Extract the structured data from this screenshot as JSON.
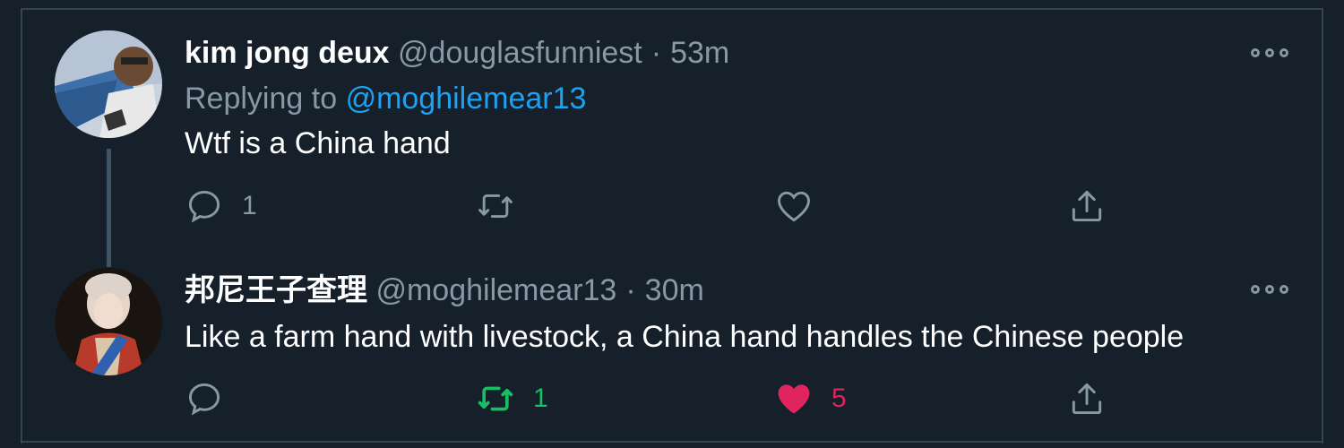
{
  "colors": {
    "background": "#15202b",
    "border": "#38444d",
    "secondary_text": "#8899a6",
    "link": "#1da1f2",
    "retweet_active": "#17bf63",
    "like_active": "#e0245e"
  },
  "tweets": [
    {
      "display_name": "kim jong deux",
      "handle": "@douglasfunniest",
      "separator": "·",
      "time": "53m",
      "replying_prefix": "Replying to",
      "replying_to": "@moghilemear13",
      "text": "Wtf is a China hand",
      "avatar_icon": "avatar-man-photo",
      "actions": {
        "reply_icon": "reply-icon",
        "reply_count": "1",
        "retweet_icon": "retweet-icon",
        "retweet_count": "",
        "like_icon": "heart-outline-icon",
        "like_count": "",
        "share_icon": "share-icon"
      }
    },
    {
      "display_name": "邦尼王子查理",
      "handle": "@moghilemear13",
      "separator": "·",
      "time": "30m",
      "text": "Like a farm hand with livestock, a China hand handles the Chinese people",
      "avatar_icon": "avatar-portrait-painting",
      "actions": {
        "reply_icon": "reply-icon",
        "reply_count": "",
        "retweet_icon": "retweet-active-icon",
        "retweet_count": "1",
        "like_icon": "heart-filled-icon",
        "like_count": "5",
        "share_icon": "share-icon"
      }
    }
  ]
}
